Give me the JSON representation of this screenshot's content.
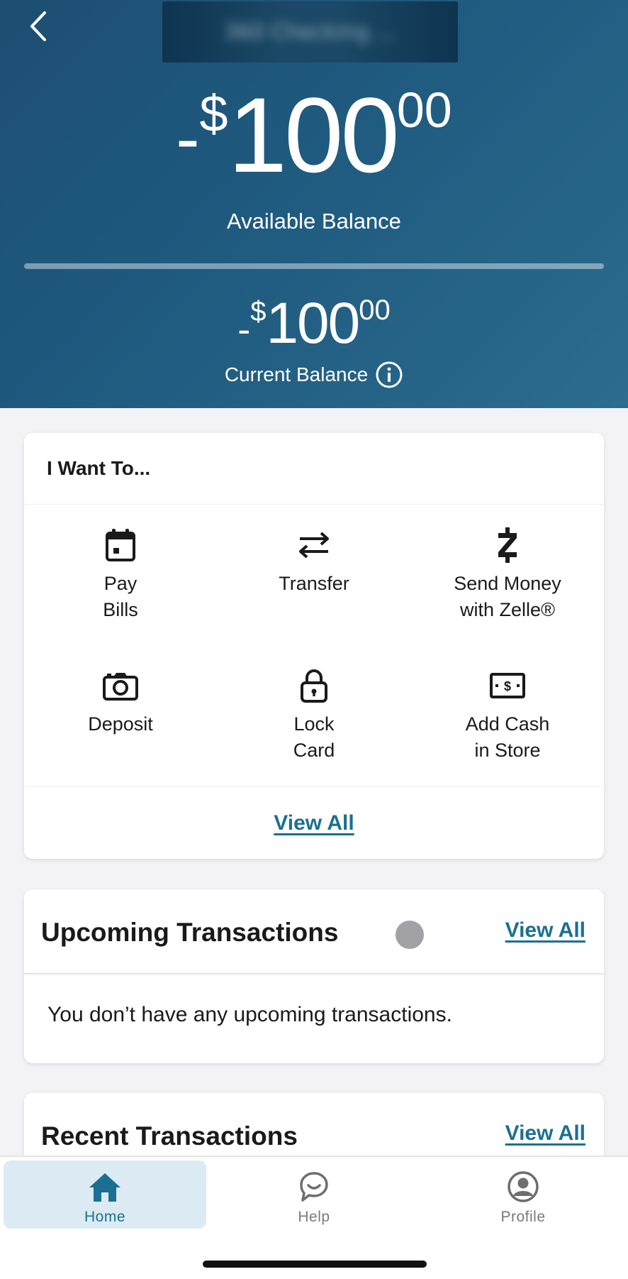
{
  "header": {
    "account_name_obscured": "360 Checking ...",
    "available": {
      "sign": "-",
      "dollar": "$",
      "whole": "100",
      "cents": "00",
      "label": "Available Balance"
    },
    "current": {
      "sign": "-",
      "dollar": "$",
      "whole": "100",
      "cents": "00",
      "label": "Current Balance"
    },
    "colors": {
      "gradient_start": "#1d4e72",
      "gradient_end": "#2c6c8e"
    }
  },
  "want_to": {
    "title": "I Want To...",
    "actions": [
      {
        "label": "Pay\nBills",
        "icon": "calendar-icon"
      },
      {
        "label": "Transfer",
        "icon": "transfer-arrows-icon"
      },
      {
        "label": "Send Money\nwith Zelle®",
        "icon": "zelle-icon"
      },
      {
        "label": "Deposit",
        "icon": "camera-icon"
      },
      {
        "label": "Lock\nCard",
        "icon": "lock-icon"
      },
      {
        "label": "Add Cash\nin Store",
        "icon": "cash-icon"
      }
    ],
    "view_all": "View All"
  },
  "upcoming": {
    "title": "Upcoming Transactions",
    "view_all": "View All",
    "empty_message": "You don’t have any upcoming transactions."
  },
  "recent": {
    "title": "Recent Transactions",
    "view_all": "View All"
  },
  "tabs": [
    {
      "label": "Home",
      "icon": "home-icon",
      "active": true
    },
    {
      "label": "Help",
      "icon": "chat-bubble-icon",
      "active": false
    },
    {
      "label": "Profile",
      "icon": "profile-icon",
      "active": false
    }
  ],
  "accent_color": "#1b6f92"
}
